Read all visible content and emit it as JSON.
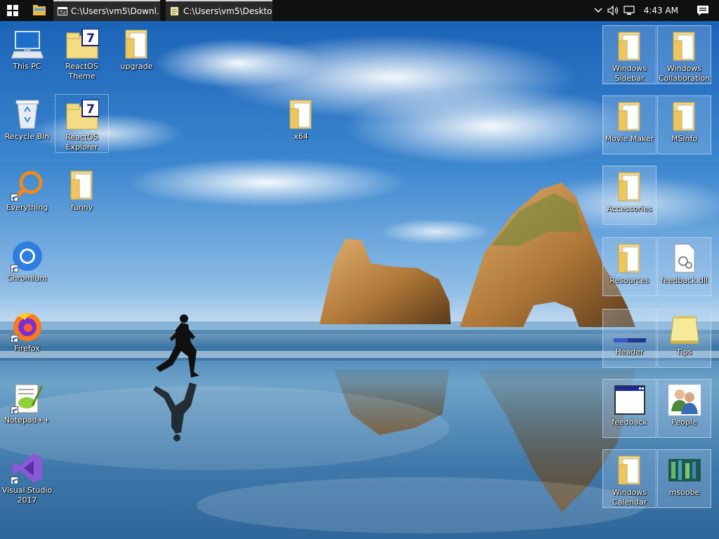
{
  "taskbar": {
    "tasks": [
      {
        "label": "C:\\Users\\vm5\\Downl..."
      },
      {
        "label": "C:\\Users\\vm5\\Deskto..."
      }
    ],
    "clock": "4:43 AM",
    "icons": {
      "start": "windows-logo-icon",
      "explorer": "folder-icon",
      "tray_chevron": "chevron-down-icon",
      "volume": "speaker-icon",
      "network": "network-icon",
      "notifications": "action-center-icon"
    }
  },
  "desktop": {
    "left_icons": [
      {
        "label": "This PC"
      },
      {
        "label": "ReactOS Theme"
      },
      {
        "label": "upgrade"
      },
      {
        "label": "Recycle Bin"
      },
      {
        "label": "ReactOS Explorer"
      },
      {
        "label": "x64"
      },
      {
        "label": "Everything"
      },
      {
        "label": "funny"
      },
      {
        "label": "Chromium"
      },
      {
        "label": "Firefox"
      },
      {
        "label": "Notepad++"
      },
      {
        "label": "Visual Studio 2017"
      }
    ],
    "right_icons": [
      {
        "label": "Windows Sidebar"
      },
      {
        "label": "Windows Collaboration"
      },
      {
        "label": "Movie Maker"
      },
      {
        "label": "MSInfo"
      },
      {
        "label": "Accessories"
      },
      {
        "label": "Resources"
      },
      {
        "label": "feedback.dll"
      },
      {
        "label": "Header"
      },
      {
        "label": "Tips"
      },
      {
        "label": "feedback"
      },
      {
        "label": "People"
      },
      {
        "label": "Windows Calendar"
      },
      {
        "label": "msoobe"
      }
    ]
  }
}
